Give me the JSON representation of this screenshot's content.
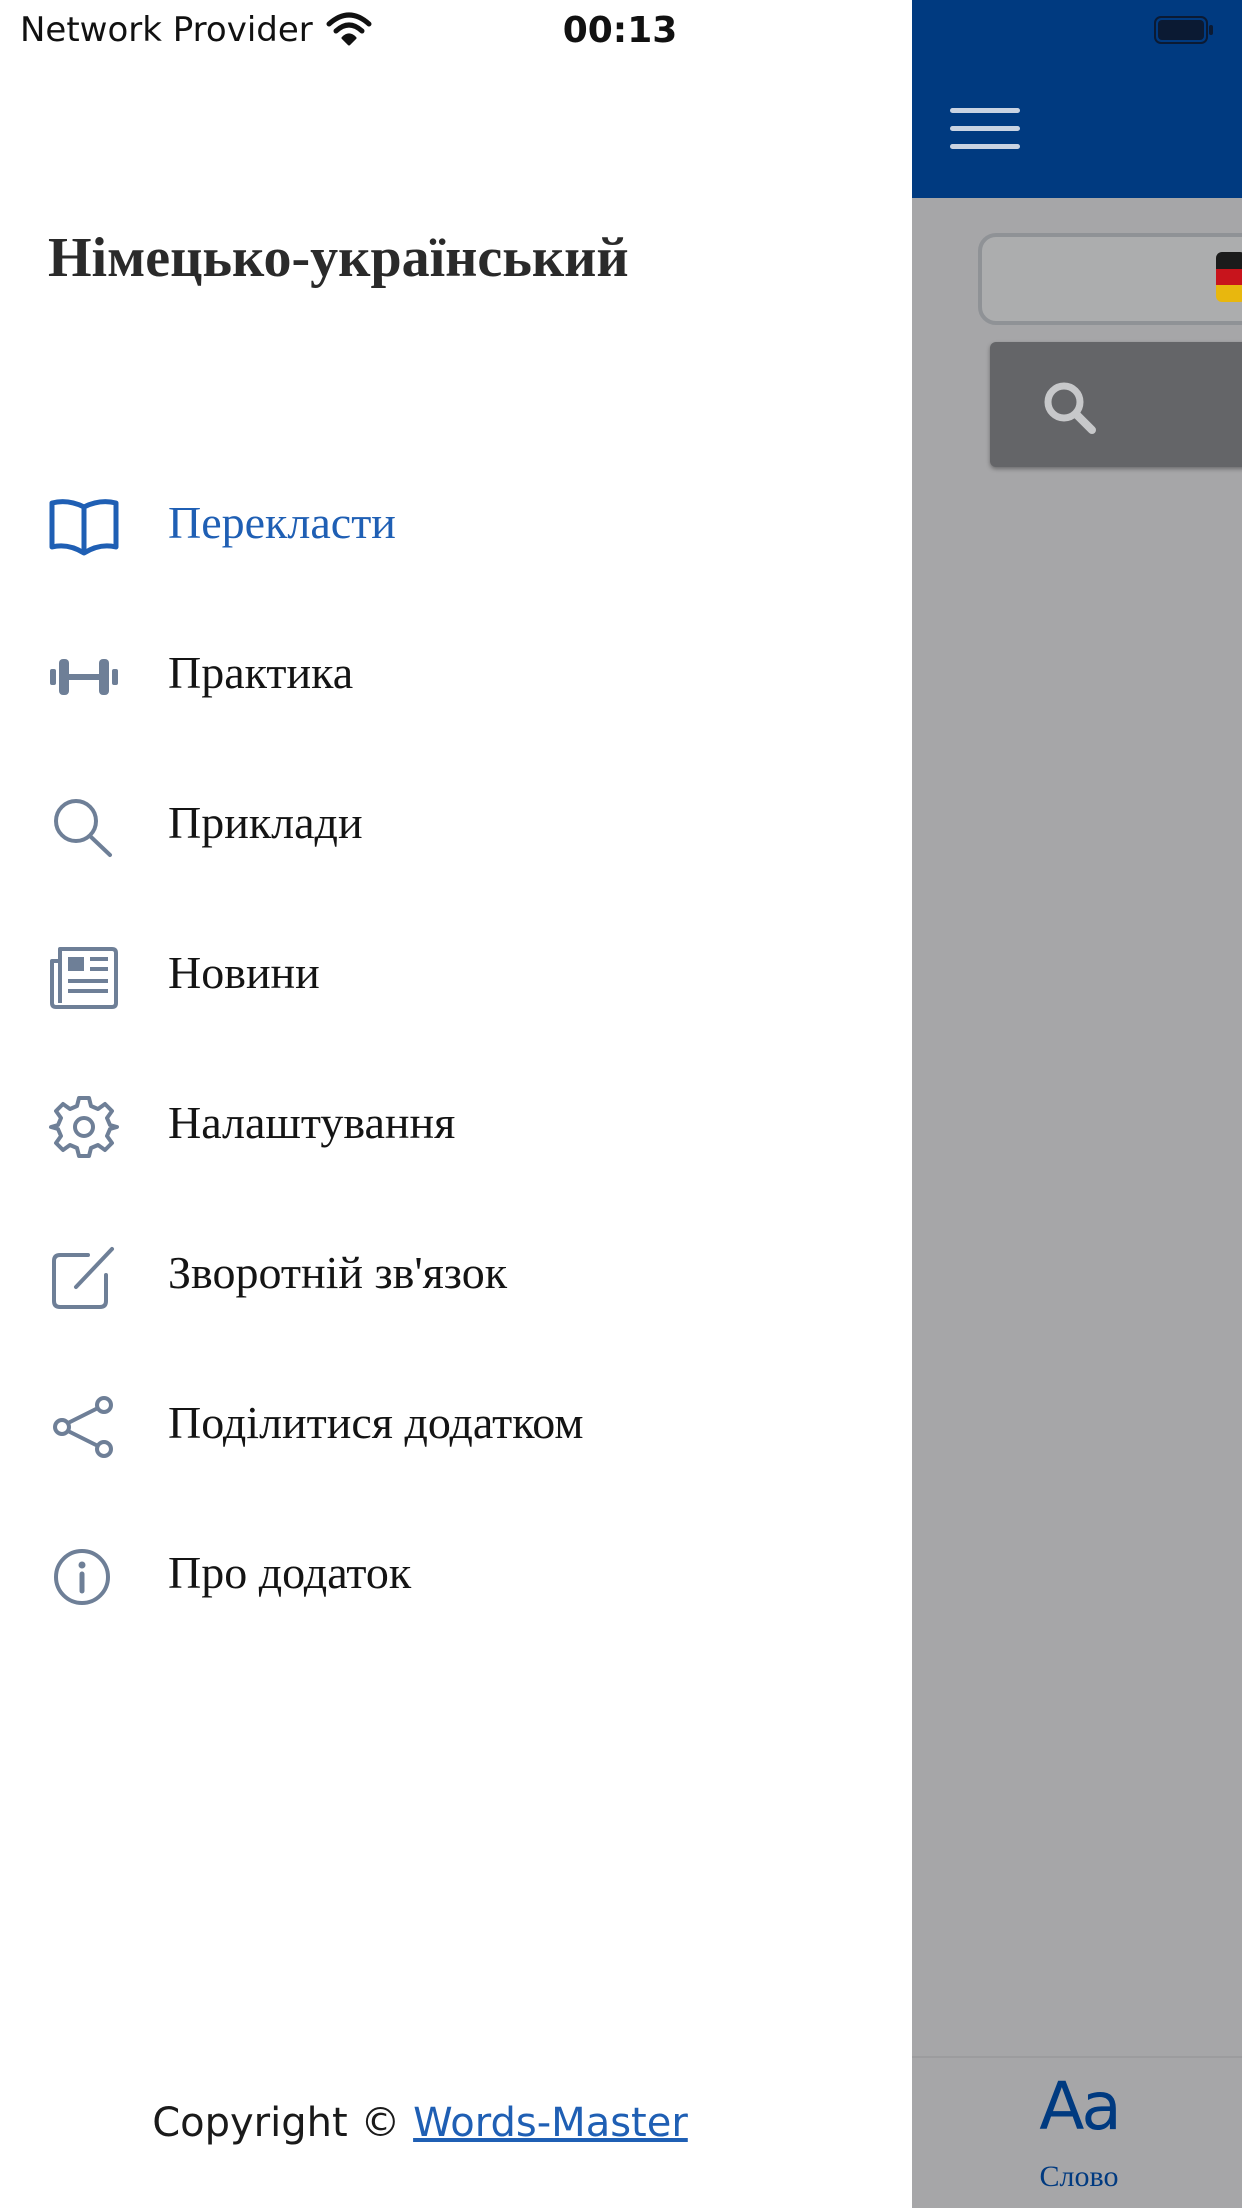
{
  "status_bar": {
    "carrier": "Network Provider",
    "time": "00:13"
  },
  "drawer": {
    "title": "Німецько-український",
    "items": [
      {
        "label": "Перекласти",
        "icon": "book-icon",
        "active": true
      },
      {
        "label": "Практика",
        "icon": "dumbbell-icon",
        "active": false
      },
      {
        "label": "Приклади",
        "icon": "search-icon",
        "active": false
      },
      {
        "label": "Новини",
        "icon": "newspaper-icon",
        "active": false
      },
      {
        "label": "Налаштування",
        "icon": "gear-icon",
        "active": false
      },
      {
        "label": "Зворотній зв'язок",
        "icon": "edit-icon",
        "active": false
      },
      {
        "label": "Поділитися додатком",
        "icon": "share-icon",
        "active": false
      },
      {
        "label": "Про додаток",
        "icon": "info-icon",
        "active": false
      }
    ],
    "footer": {
      "prefix": "Copyright © ",
      "link": "Words-Master"
    }
  },
  "background_app": {
    "tab": {
      "icon_text": "Aa",
      "label": "Слово"
    }
  },
  "colors": {
    "accent": "#1f5fb4",
    "header": "#003a80",
    "icon": "#6e7f97"
  }
}
